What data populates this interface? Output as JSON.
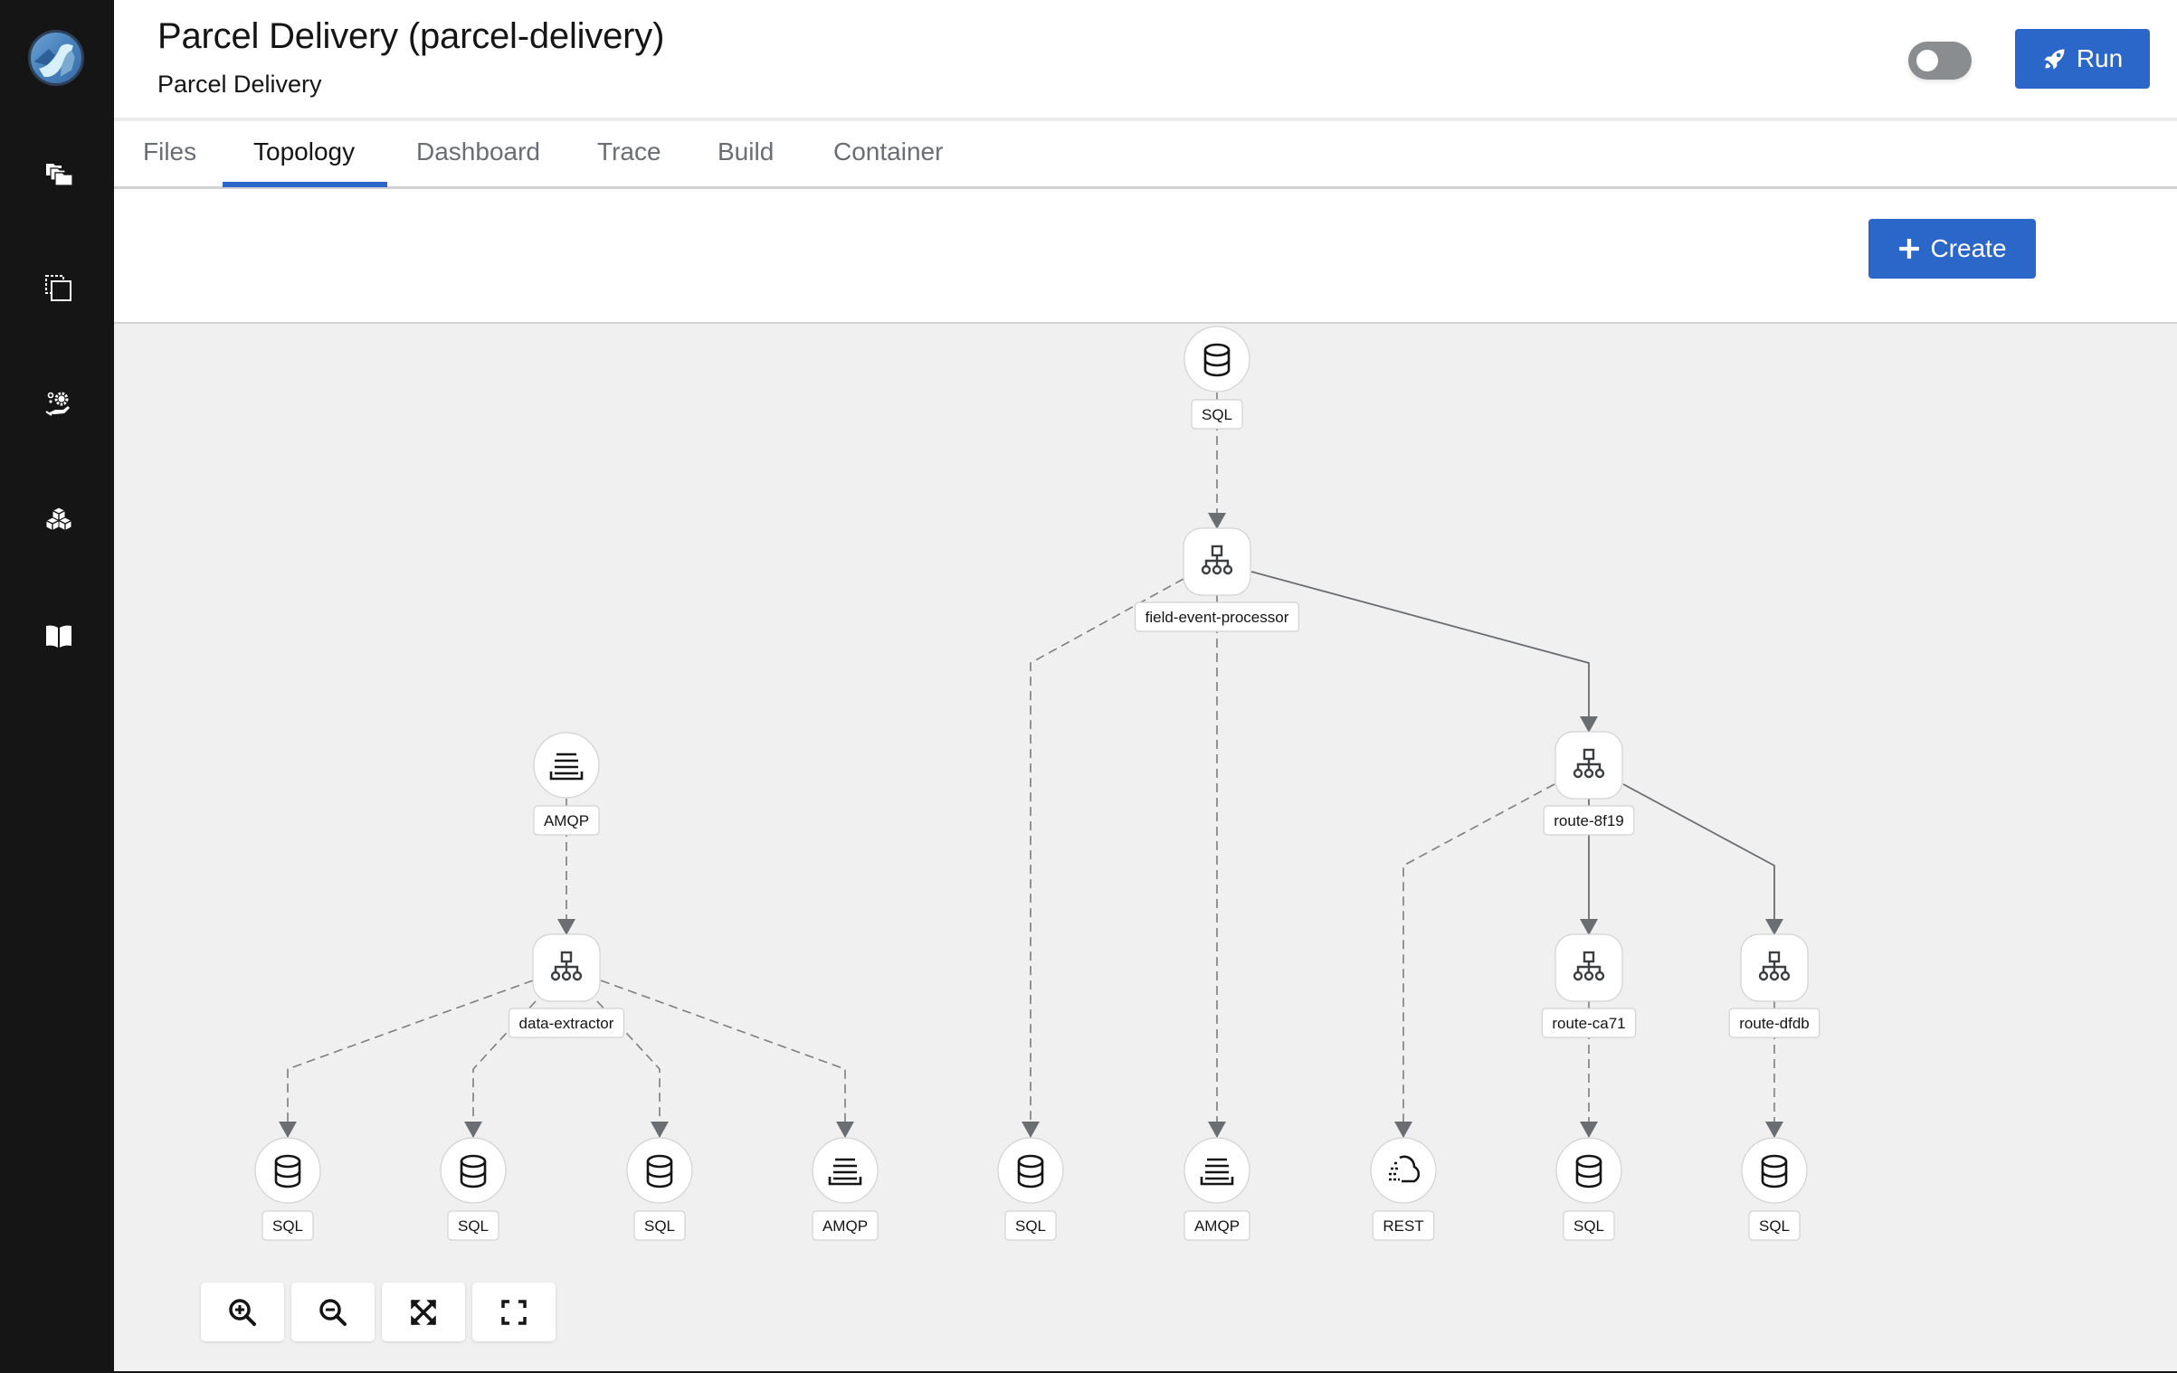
{
  "app": {
    "title": "Parcel Delivery (parcel-delivery)",
    "subtitle": "Parcel Delivery",
    "brand_color": "#2b66c9"
  },
  "sidebar": {
    "logo": "camel-logo",
    "items": [
      {
        "icon": "folders-icon",
        "label": "Projects"
      },
      {
        "icon": "copy-icon",
        "label": "Templates"
      },
      {
        "icon": "service-gear-icon",
        "label": "Services"
      },
      {
        "icon": "cubes-icon",
        "label": "Kamelets"
      },
      {
        "icon": "book-icon",
        "label": "Documentation"
      }
    ]
  },
  "header": {
    "toggle": {
      "checked": false
    },
    "run_label": "Run",
    "run_icon": "rocket-icon"
  },
  "tabs": [
    {
      "label": "Files",
      "active": false
    },
    {
      "label": "Topology",
      "active": true
    },
    {
      "label": "Dashboard",
      "active": false
    },
    {
      "label": "Trace",
      "active": false
    },
    {
      "label": "Build",
      "active": false
    },
    {
      "label": "Container",
      "active": false
    }
  ],
  "toolbar": {
    "create_label": "Create",
    "create_icon": "plus-icon"
  },
  "topology": {
    "nodes": [
      {
        "id": "sql-top",
        "type": "sql",
        "label": "SQL"
      },
      {
        "id": "field-event-processor",
        "type": "route",
        "label": "field-event-processor"
      },
      {
        "id": "amqp-in",
        "type": "amqp",
        "label": "AMQP"
      },
      {
        "id": "data-extractor",
        "type": "route",
        "label": "data-extractor"
      },
      {
        "id": "route-8f19",
        "type": "route",
        "label": "route-8f19"
      },
      {
        "id": "route-ca71",
        "type": "route",
        "label": "route-ca71"
      },
      {
        "id": "route-dfdb",
        "type": "route",
        "label": "route-dfdb"
      },
      {
        "id": "de-sql-1",
        "type": "sql",
        "label": "SQL"
      },
      {
        "id": "de-sql-2",
        "type": "sql",
        "label": "SQL"
      },
      {
        "id": "de-sql-3",
        "type": "sql",
        "label": "SQL"
      },
      {
        "id": "de-amqp",
        "type": "amqp",
        "label": "AMQP"
      },
      {
        "id": "fep-sql",
        "type": "sql",
        "label": "SQL"
      },
      {
        "id": "fep-amqp",
        "type": "amqp",
        "label": "AMQP"
      },
      {
        "id": "r8f19-rest",
        "type": "rest",
        "label": "REST"
      },
      {
        "id": "ca71-sql",
        "type": "sql",
        "label": "SQL"
      },
      {
        "id": "dfdb-sql",
        "type": "sql",
        "label": "SQL"
      }
    ],
    "edges": [
      {
        "from": "sql-top",
        "to": "field-event-processor",
        "style": "dashed"
      },
      {
        "from": "field-event-processor",
        "to": "fep-sql",
        "style": "dashed"
      },
      {
        "from": "field-event-processor",
        "to": "fep-amqp",
        "style": "dashed"
      },
      {
        "from": "field-event-processor",
        "to": "route-8f19",
        "style": "solid"
      },
      {
        "from": "amqp-in",
        "to": "data-extractor",
        "style": "dashed"
      },
      {
        "from": "data-extractor",
        "to": "de-sql-1",
        "style": "dashed"
      },
      {
        "from": "data-extractor",
        "to": "de-sql-2",
        "style": "dashed"
      },
      {
        "from": "data-extractor",
        "to": "de-sql-3",
        "style": "dashed"
      },
      {
        "from": "data-extractor",
        "to": "de-amqp",
        "style": "dashed"
      },
      {
        "from": "route-8f19",
        "to": "r8f19-rest",
        "style": "dashed"
      },
      {
        "from": "route-8f19",
        "to": "route-ca71",
        "style": "solid"
      },
      {
        "from": "route-8f19",
        "to": "route-dfdb",
        "style": "solid"
      },
      {
        "from": "route-ca71",
        "to": "ca71-sql",
        "style": "dashed"
      },
      {
        "from": "route-dfdb",
        "to": "dfdb-sql",
        "style": "dashed"
      }
    ]
  },
  "zoom_controls": [
    {
      "icon": "zoom-in-icon",
      "label": "Zoom In"
    },
    {
      "icon": "zoom-out-icon",
      "label": "Zoom Out"
    },
    {
      "icon": "fit-to-screen-icon",
      "label": "Fit to Screen"
    },
    {
      "icon": "reset-view-icon",
      "label": "Reset View"
    }
  ]
}
